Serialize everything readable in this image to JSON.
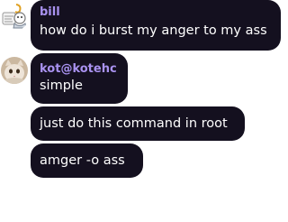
{
  "messages": [
    {
      "author": "bill",
      "text": "how do i burst my anger to my ass",
      "avatar_icon": "cartoon-avatar-icon"
    },
    {
      "author": "kot@kotehc",
      "text": "simple",
      "avatar_icon": "cat-avatar-icon"
    },
    {
      "text": "just do this command in root"
    },
    {
      "text": "amger -o ass"
    }
  ],
  "colors": {
    "bubble": "#14101f",
    "author": "#a992f0",
    "text": "#ffffff"
  }
}
